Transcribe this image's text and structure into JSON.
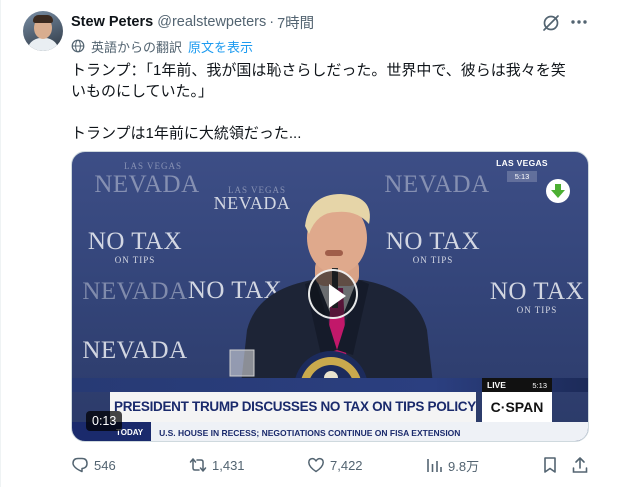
{
  "author": {
    "name": "Stew Peters",
    "handle": "@realstewpeters",
    "separator": "·",
    "time": "7時間"
  },
  "translation": {
    "label": "英語からの翻訳",
    "show_original": "原文を表示"
  },
  "tweet_text": {
    "line1": "トランプ：「1年前、我が国は恥さらしだった。世界中で、彼らは我々を笑",
    "line2": "いものにしていた。」",
    "line3": "トランプは1年前に大統領だった..."
  },
  "video": {
    "duration": "0:13",
    "backdrop": {
      "city_top": "LAS VEGAS",
      "nevada": "NEVADA",
      "no_tax": "NO TAX",
      "on_tips": "ON TIPS"
    },
    "bug": {
      "location": "LAS VEGAS",
      "clock": "5:13"
    },
    "chyron": "PRESIDENT TRUMP DISCUSSES NO TAX ON TIPS POLICY",
    "live": "LIVE",
    "live_clock": "5:13",
    "network": "C·SPAN",
    "ticker_label": "TODAY",
    "ticker": "U.S. HOUSE IN RECESS; NEGOTIATIONS CONTINUE ON FISA EXTENSION"
  },
  "actions": {
    "replies": "546",
    "reposts": "1,431",
    "likes": "7,422",
    "views": "9.8万"
  },
  "icons": {
    "grok": "grok-icon",
    "more": "more-icon",
    "globe": "globe-icon",
    "play": "play-icon",
    "download": "download-icon",
    "reply": "reply-icon",
    "repost": "repost-icon",
    "like": "heart-icon",
    "views": "views-icon",
    "bookmark": "bookmark-icon",
    "share": "share-icon"
  },
  "colors": {
    "accent": "#1d9bf0",
    "text": "#0f1419",
    "secondary": "#536471",
    "download_green": "#4caf32"
  }
}
